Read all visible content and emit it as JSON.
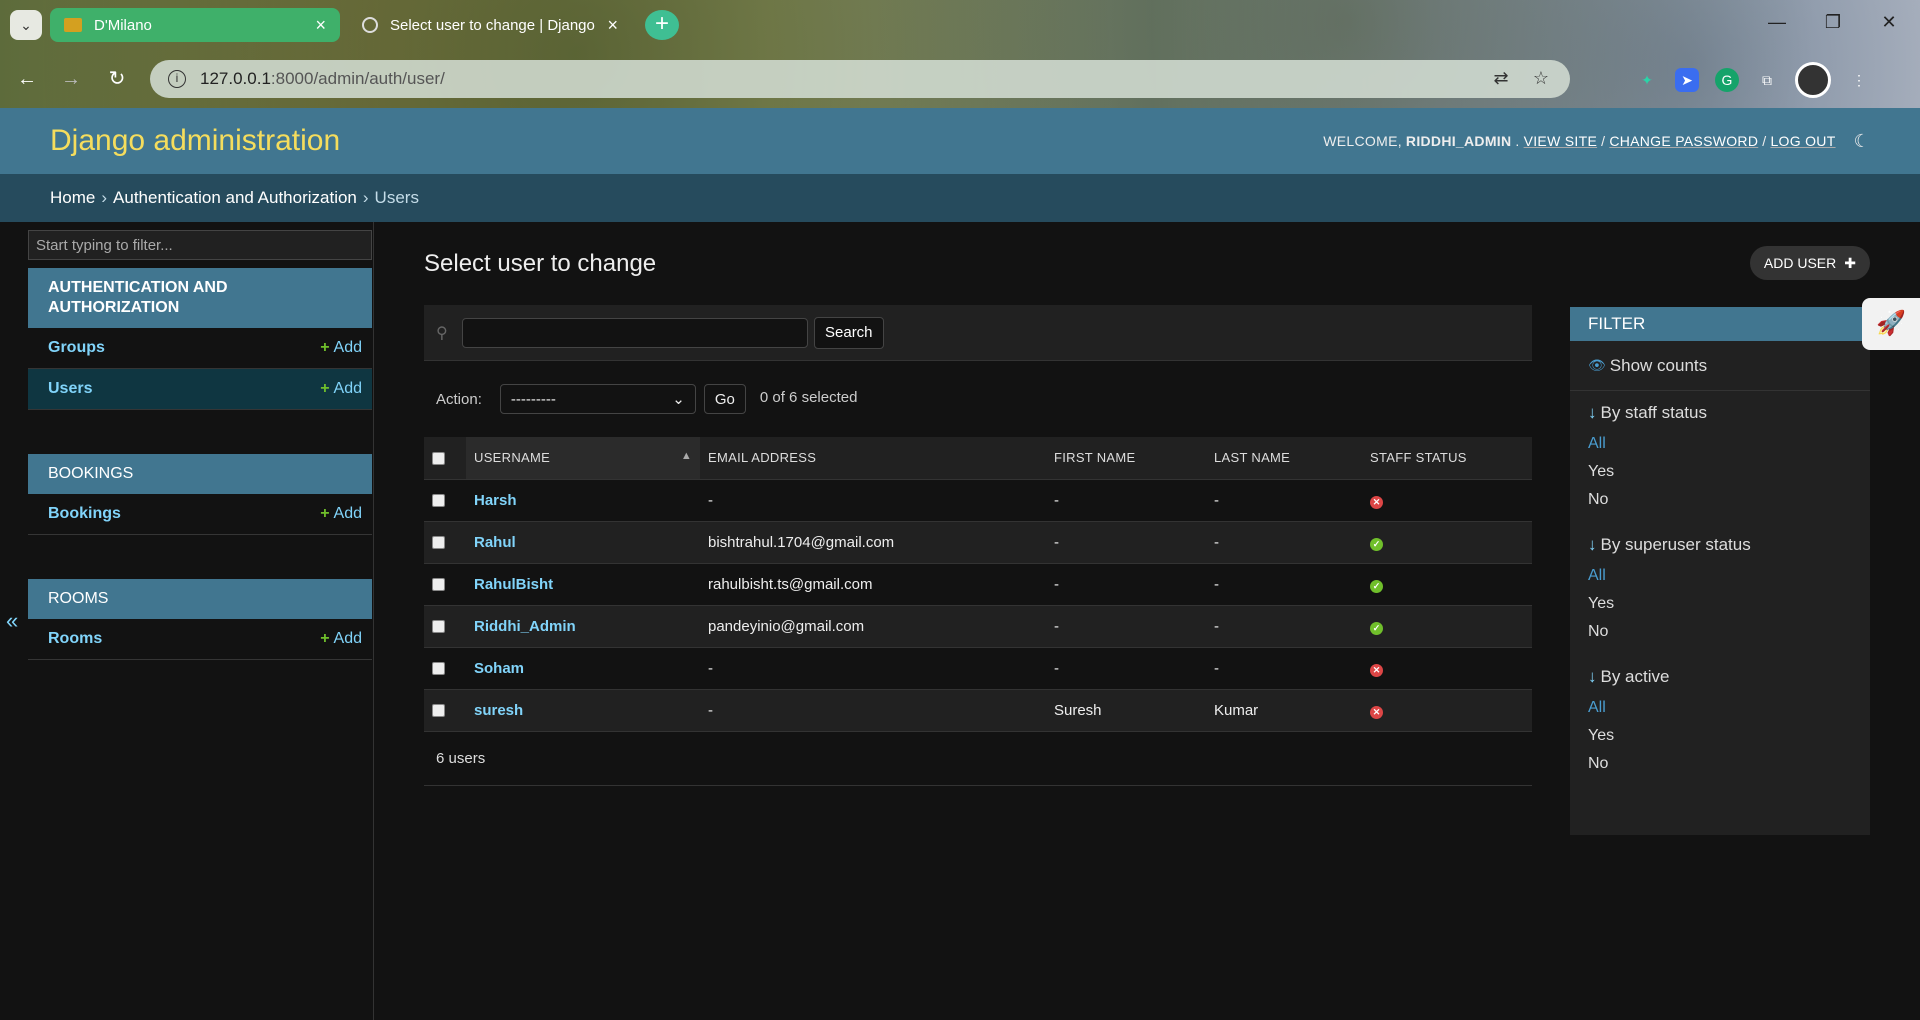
{
  "browser": {
    "tabs": [
      {
        "label": "D'Milano"
      },
      {
        "label": "Select user to change | Django"
      }
    ],
    "url_host": "127.0.0.1",
    "url_path": ":8000/admin/auth/user/"
  },
  "header": {
    "brand": "Django administration",
    "welcome": "WELCOME,",
    "username": "RIDDHI_ADMIN",
    "view_site": "VIEW SITE",
    "change_password": "CHANGE PASSWORD",
    "log_out": "LOG OUT"
  },
  "breadcrumbs": {
    "home": "Home",
    "app": "Authentication and Authorization",
    "current": "Users"
  },
  "sidebar": {
    "filter_placeholder": "Start typing to filter...",
    "modules": [
      {
        "caption": "AUTHENTICATION AND AUTHORIZATION",
        "rows": [
          {
            "name": "Groups",
            "add": "Add"
          },
          {
            "name": "Users",
            "add": "Add"
          }
        ]
      },
      {
        "caption": "BOOKINGS",
        "rows": [
          {
            "name": "Bookings",
            "add": "Add"
          }
        ]
      },
      {
        "caption": "ROOMS",
        "rows": [
          {
            "name": "Rooms",
            "add": "Add"
          }
        ]
      }
    ]
  },
  "main": {
    "title": "Select user to change",
    "add_user": "ADD USER",
    "search_button": "Search",
    "action_label": "Action:",
    "action_value": "---------",
    "go": "Go",
    "selected_count": "0 of 6 selected",
    "columns": [
      "USERNAME",
      "EMAIL ADDRESS",
      "FIRST NAME",
      "LAST NAME",
      "STAFF STATUS"
    ],
    "rows": [
      {
        "username": "Harsh",
        "email": "-",
        "first": "-",
        "last": "-",
        "staff": "no"
      },
      {
        "username": "Rahul",
        "email": "bishtrahul.1704@gmail.com",
        "first": "-",
        "last": "-",
        "staff": "yes"
      },
      {
        "username": "RahulBisht",
        "email": "rahulbisht.ts@gmail.com",
        "first": "-",
        "last": "-",
        "staff": "yes"
      },
      {
        "username": "Riddhi_Admin",
        "email": "pandeyinio@gmail.com",
        "first": "-",
        "last": "-",
        "staff": "yes"
      },
      {
        "username": "Soham",
        "email": "-",
        "first": "-",
        "last": "-",
        "staff": "no"
      },
      {
        "username": "suresh",
        "email": "-",
        "first": "Suresh",
        "last": "Kumar",
        "staff": "no"
      }
    ],
    "total": "6 users"
  },
  "filter": {
    "title": "FILTER",
    "show_counts": "Show counts",
    "groups": [
      {
        "title": "By staff status",
        "options": [
          "All",
          "Yes",
          "No"
        ]
      },
      {
        "title": "By superuser status",
        "options": [
          "All",
          "Yes",
          "No"
        ]
      },
      {
        "title": "By active",
        "options": [
          "All",
          "Yes",
          "No"
        ]
      }
    ]
  },
  "colors": {
    "header": "#417690",
    "breadcrumbs": "#264b5d",
    "brand": "#f5dd5d",
    "link": "#81d4fa",
    "add_plus": "#70bf2b"
  }
}
